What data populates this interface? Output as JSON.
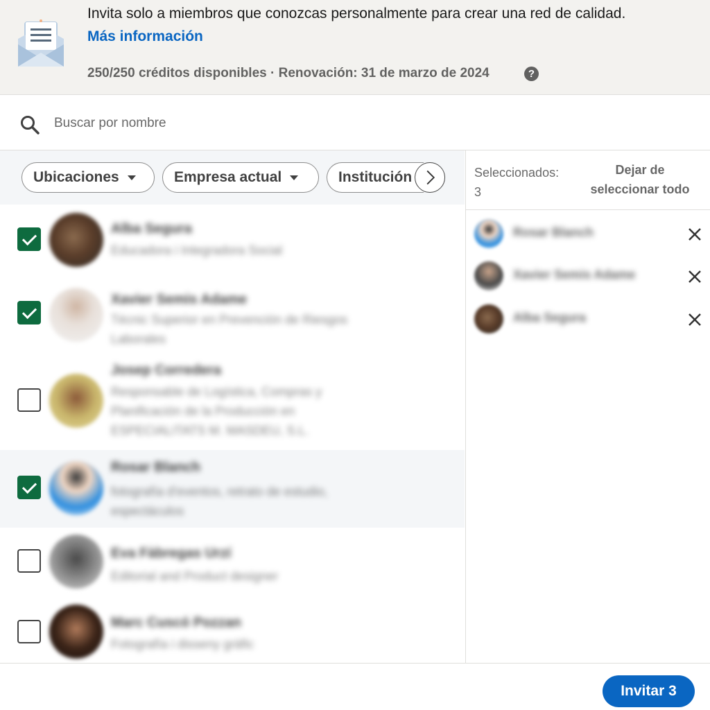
{
  "banner": {
    "message": "Invita solo a miembros que conozcas personalmente para crear una red de calidad.",
    "link_label": "Más información",
    "credits": "250/250 créditos disponibles · Renovación: 31 de marzo de 2024",
    "help_glyph": "?"
  },
  "search": {
    "placeholder": "Buscar por nombre"
  },
  "filters": [
    {
      "label": "Ubicaciones"
    },
    {
      "label": "Empresa actual"
    },
    {
      "label": "Institución"
    }
  ],
  "people": [
    {
      "name": "Alba Segura",
      "headline": "Educadora i Integradora Social",
      "checked": true
    },
    {
      "name": "Xavier Semis Adame",
      "headline": "Técnic Superior en Prevención de Riesgos Laborales",
      "checked": true
    },
    {
      "name": "Josep Corredera",
      "headline": "Responsable de Logística, Compras y Planificación de la Producción en ESPECIALITATS M. MASDEU, S.L.",
      "checked": false
    },
    {
      "name": "Rosar Blanch",
      "headline": "fotografía d'eventos, retrato de estudio, espectáculos",
      "checked": true
    },
    {
      "name": "Eva Fàbregas Urzí",
      "headline": "Editorial and Product designer",
      "checked": false
    },
    {
      "name": "Marc Cuscó Pozzan",
      "headline": "Fotografía i disseny gràfic",
      "checked": false
    }
  ],
  "selection": {
    "label": "Seleccionados:",
    "count": "3",
    "deselect_line1": "Dejar de",
    "deselect_line2": "seleccionar todo",
    "items": [
      {
        "name": "Rosar Blanch"
      },
      {
        "name": "Xavier Semis Adame"
      },
      {
        "name": "Alba Segura"
      }
    ]
  },
  "footer": {
    "invite_label": "Invitar 3"
  },
  "colors": {
    "accent": "#0a66c2",
    "checkbox_checked": "#0e6b3f",
    "banner_bg": "#f3f2ef"
  }
}
